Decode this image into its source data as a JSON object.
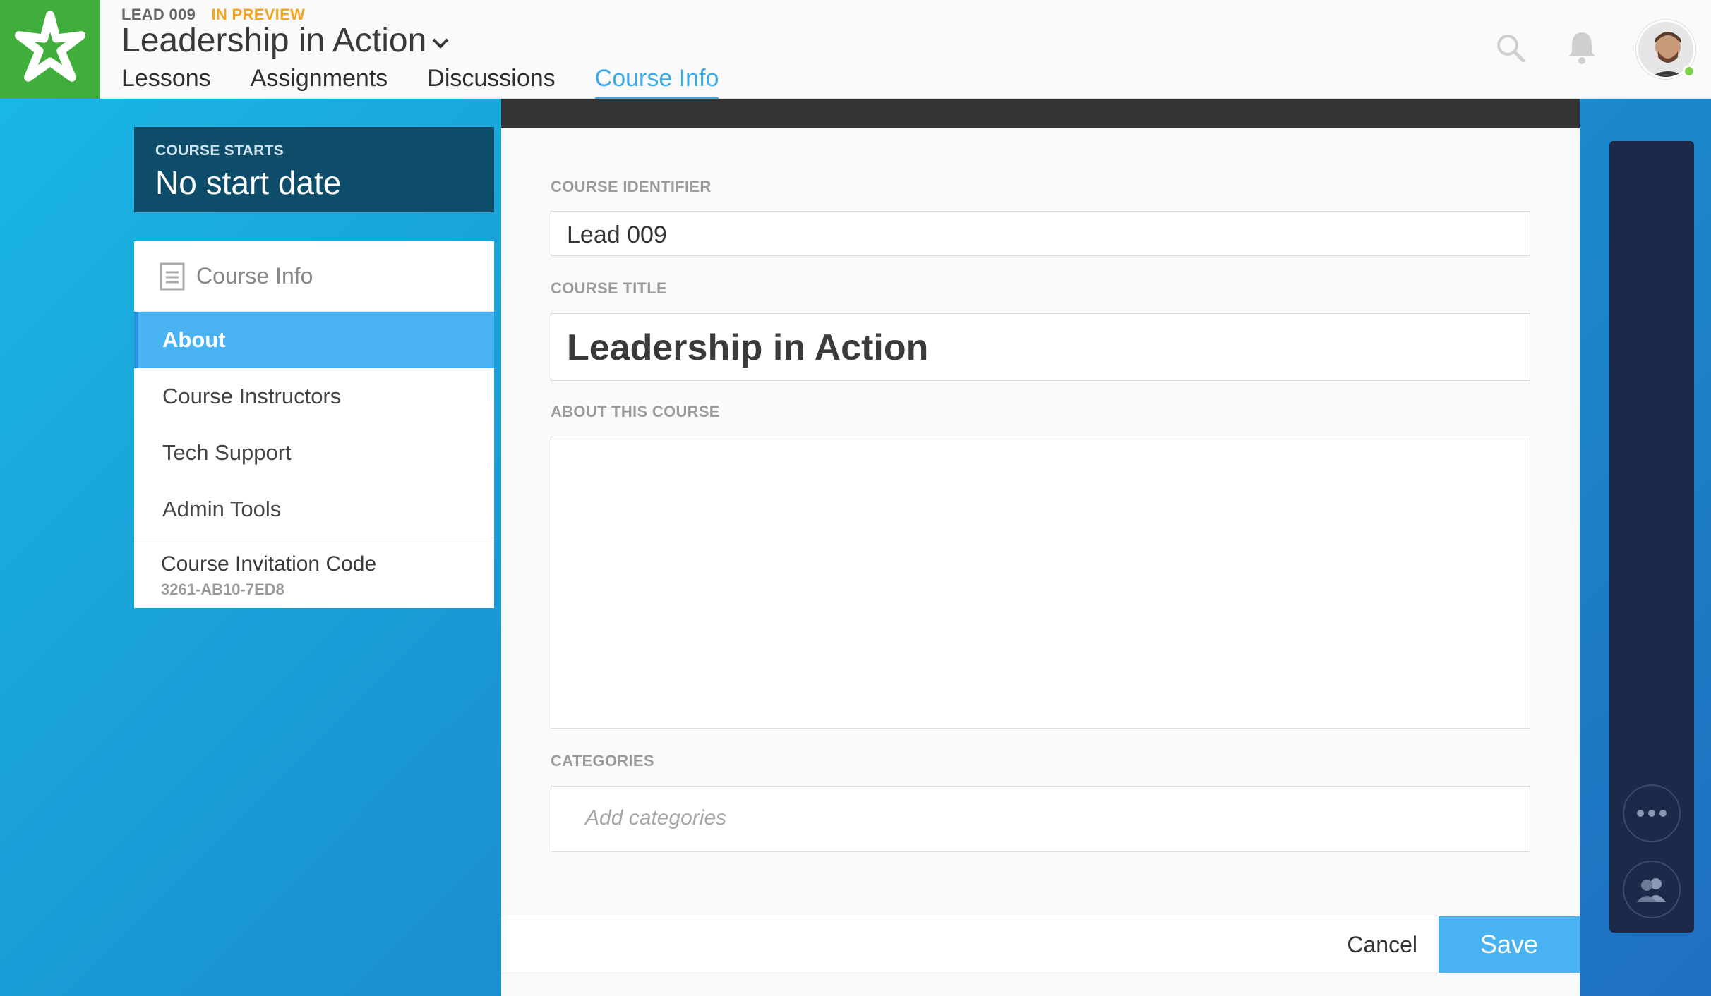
{
  "header": {
    "course_code": "LEAD 009",
    "status": "IN PREVIEW",
    "title": "Leadership in Action",
    "tabs": [
      {
        "label": "Lessons"
      },
      {
        "label": "Assignments"
      },
      {
        "label": "Discussions"
      },
      {
        "label": "Course Info",
        "active": true
      }
    ],
    "icons": [
      "search-icon",
      "bell-icon",
      "avatar"
    ]
  },
  "sidebar": {
    "course_starts_label": "COURSE STARTS",
    "course_starts_value": "No start date",
    "section_title": "Course Info",
    "items": [
      {
        "label": "About",
        "active": true
      },
      {
        "label": "Course Instructors"
      },
      {
        "label": "Tech Support"
      },
      {
        "label": "Admin Tools"
      }
    ],
    "invitation_label": "Course Invitation Code",
    "invitation_code": "3261-AB10-7ED8"
  },
  "form": {
    "identifier_label": "COURSE IDENTIFIER",
    "identifier_value": "Lead 009",
    "title_label": "COURSE TITLE",
    "title_value": "Leadership in Action",
    "about_label": "ABOUT THIS COURSE",
    "about_value": "",
    "categories_label": "CATEGORIES",
    "categories_placeholder": "Add categories"
  },
  "footer": {
    "cancel_label": "Cancel",
    "save_label": "Save"
  },
  "colors": {
    "brand_green": "#3fae3a",
    "accent_blue": "#49b3f2",
    "preview_orange": "#f5a623",
    "dark_navy": "#0e4d69"
  }
}
